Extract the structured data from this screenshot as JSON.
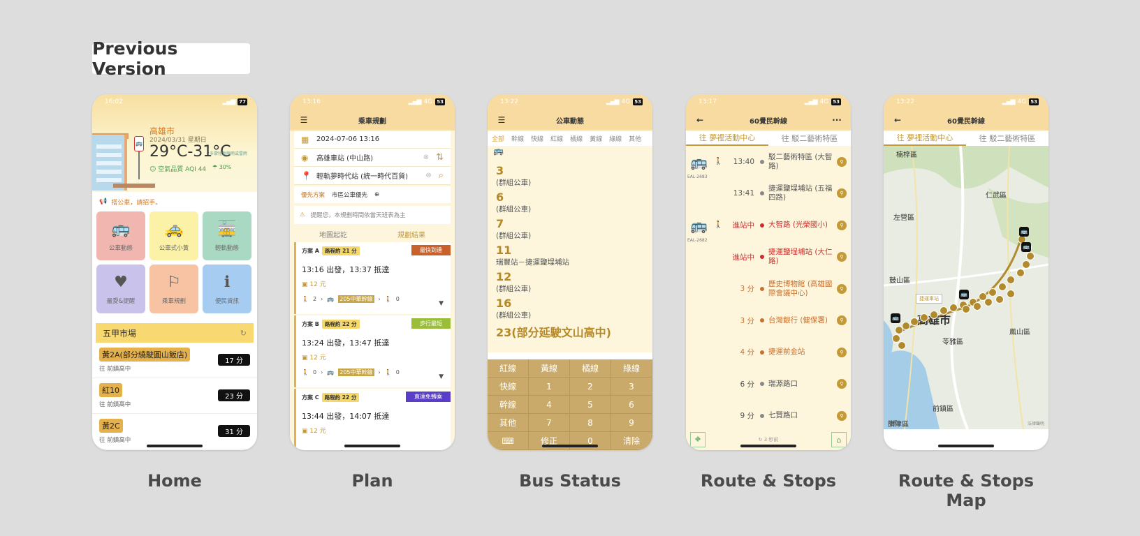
{
  "version_tag": "Previous Version",
  "labels": [
    "Home",
    "Plan",
    "Bus Status",
    "Route & Stops",
    "Route & Stops Map"
  ],
  "colors": {
    "accent": "#c49a36",
    "header": "#f7dba0",
    "body": "#fdf6dd",
    "highlight": "#f7d871"
  },
  "home": {
    "status_time": "16:02",
    "battery": "77",
    "city": "高雄市",
    "date": "2024/03/31 星期日",
    "temp": "29°C-31°C",
    "temp_note": "多雲短暫陣雨或雷雨",
    "aqi": "空氣品質 AQI 44",
    "rain": "30%",
    "ticker": "搭公車，請招手。",
    "tiles": [
      {
        "label": "公車動態",
        "icon": "bus-icon",
        "glyph": "🚌",
        "color": "#f2b6b0"
      },
      {
        "label": "公車式小黃",
        "icon": "taxi-icon",
        "glyph": "🚕",
        "color": "#fbf2a8"
      },
      {
        "label": "輕軌動態",
        "icon": "tram-icon",
        "glyph": "🚋",
        "color": "#a9d9c2"
      },
      {
        "label": "最愛&提醒",
        "icon": "bookmark-icon",
        "glyph": "♥",
        "color": "#c9c3ec"
      },
      {
        "label": "乘車規劃",
        "icon": "route-plan-icon",
        "glyph": "⚐",
        "color": "#f7c3a3"
      },
      {
        "label": "便民資訊",
        "icon": "info-icon",
        "glyph": "ℹ",
        "color": "#a6ccf2"
      }
    ],
    "section_title": "五甲市場",
    "arrivals": [
      {
        "route": "黃2A(部分繞駛圓山飯店)",
        "dest": "往 前鎮高中",
        "eta": "17 分"
      },
      {
        "route": "紅10",
        "dest": "往 前鎮高中",
        "eta": "23 分"
      },
      {
        "route": "黃2C",
        "dest": "往 前鎮高中",
        "eta": "31 分"
      }
    ]
  },
  "plan": {
    "status_time": "13:16",
    "network": "4G",
    "battery": "53",
    "title": "乘車規劃",
    "datetime": "2024-07-06 13:16",
    "origin": "高雄車站 (中山路)",
    "destination": "輕軌夢時代站 (統一時代百貨)",
    "pref_label": "優先方案",
    "pref_value": "市區公車優先",
    "notice": "提醒您，本規劃時間依當天班表為主",
    "tabs": [
      "地圖起訖",
      "規劃結果"
    ],
    "plans": [
      {
        "name": "方案 A",
        "duration": "路程約 21 分",
        "tag": "最快到達",
        "tag_color": "#c8622a",
        "time": "13:16 出發，13:37 抵達",
        "fare": "12 元",
        "walk_a": "2",
        "bus": "205中華幹線",
        "walk_b": "0"
      },
      {
        "name": "方案 B",
        "duration": "路程約 22 分",
        "tag": "步行最短",
        "tag_color": "#9bbe3a",
        "time": "13:24 出發，13:47 抵達",
        "fare": "12 元",
        "walk_a": "0",
        "bus": "205中華幹線",
        "walk_b": "0"
      },
      {
        "name": "方案 C",
        "duration": "路程約 22 分",
        "tag": "直達免轉乘",
        "tag_color": "#5a3ec8",
        "time": "13:44 出發，14:07 抵達",
        "fare": "12 元",
        "walk_a": "",
        "bus": "",
        "walk_b": ""
      }
    ]
  },
  "status": {
    "status_time": "13:22",
    "network": "4G",
    "battery": "53",
    "title": "公車動態",
    "filters": [
      "全部",
      "幹線",
      "快線",
      "紅線",
      "橘線",
      "黃線",
      "綠線",
      "其他"
    ],
    "routes": [
      {
        "num": "3",
        "desc": "(群組公車)"
      },
      {
        "num": "6",
        "desc": "(群組公車)"
      },
      {
        "num": "7",
        "desc": "(群組公車)"
      },
      {
        "num": "11",
        "desc": "瑞豐站－捷運鹽埕埔站"
      },
      {
        "num": "12",
        "desc": "(群組公車)"
      },
      {
        "num": "16",
        "desc": "(群組公車)"
      },
      {
        "num": "23(部分延駛文山高中)",
        "desc": ""
      }
    ],
    "keys": [
      "紅線",
      "黃線",
      "橘線",
      "綠線",
      "快線",
      "1",
      "2",
      "3",
      "幹線",
      "4",
      "5",
      "6",
      "其他",
      "7",
      "8",
      "9",
      "⌨",
      "修正",
      "0",
      "清除"
    ]
  },
  "route": {
    "status_time": "13:17",
    "network": "4G",
    "battery": "53",
    "title": "60覺民幹線",
    "dir_a": "往 夢裡活動中心",
    "dir_b": "往 駁二藝術特區",
    "stops": [
      {
        "eta": "13:40",
        "name": "駁二藝術特區 (大智路)",
        "state": "",
        "bus": "🚌",
        "plate": "EAL-2683",
        "walk": "🚶"
      },
      {
        "eta": "13:41",
        "name": "捷運鹽埕埔站 (五福四路)",
        "state": "",
        "bus": "",
        "plate": "",
        "walk": ""
      },
      {
        "eta": "進站中",
        "name": "大智路 (光榮國小)",
        "state": "in",
        "bus": "🚌",
        "plate": "EAL-2682",
        "walk": "🚶"
      },
      {
        "eta": "進站中",
        "name": "捷運鹽埕埔站 (大仁路)",
        "state": "in",
        "bus": "",
        "plate": "",
        "walk": ""
      },
      {
        "eta": "3 分",
        "name": "歷史博物館 (高雄國際會議中心)",
        "state": "soon",
        "bus": "",
        "plate": "",
        "walk": ""
      },
      {
        "eta": "3 分",
        "name": "台灣銀行 (健保署)",
        "state": "soon",
        "bus": "",
        "plate": "",
        "walk": ""
      },
      {
        "eta": "4 分",
        "name": "捷運前金站",
        "state": "soon",
        "bus": "",
        "plate": "",
        "walk": ""
      },
      {
        "eta": "6 分",
        "name": "瑞源路口",
        "state": "",
        "bus": "",
        "plate": "",
        "walk": ""
      },
      {
        "eta": "9 分",
        "name": "七賢路口",
        "state": "",
        "bus": "",
        "plate": "",
        "walk": ""
      }
    ],
    "refresh": "3 秒前"
  },
  "map": {
    "status_time": "13:22",
    "network": "4G",
    "battery": "53",
    "title": "60覺民幹線",
    "dir_a": "往 夢裡活動中心",
    "dir_b": "往 駁二藝術特區",
    "districts": [
      "楠梓區",
      "仁武區",
      "左營區",
      "鼓山區",
      "高雄市",
      "鳳山區",
      "苓雅區",
      "旗津區",
      "前鎮區"
    ],
    "callout": "捷運車站",
    "credit": "地圖",
    "legal": "法律聲明"
  }
}
